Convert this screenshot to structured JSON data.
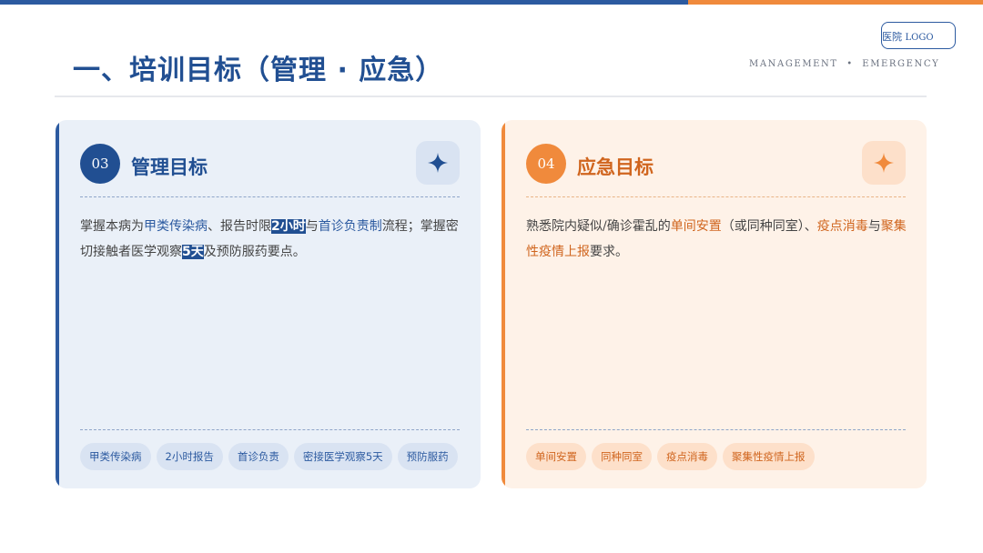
{
  "header": {
    "title": "一、培训目标（管理 · 应急）",
    "logo_text": "医院",
    "logo_suffix": "LOGO",
    "subtitle": "MANAGEMENT  •  EMERGENCY"
  },
  "colors": {
    "primary_blue": "#214f92",
    "accent_orange": "#f08a3c"
  },
  "cards": [
    {
      "number": "03",
      "title": "管理目标",
      "icon": "sparkle-icon",
      "text": {
        "t1": "掌握本病为",
        "h1": "甲类传染病",
        "t2": "、报告时限",
        "m1": "2小时",
        "t3": "与",
        "h2": "首诊负责制",
        "t4": "流程；掌握密切接触者医学观察",
        "m2": "5天",
        "t5": "及预防服药要点。"
      },
      "tags": [
        "甲类传染病",
        "2小时报告",
        "首诊负责",
        "密接医学观察5天",
        "预防服药"
      ]
    },
    {
      "number": "04",
      "title": "应急目标",
      "icon": "sparkle-icon",
      "text": {
        "t1": "熟悉院内疑似/确诊霍乱的",
        "h1": "单间安置",
        "t2": "（或同种同室）、",
        "h2": "疫点消毒",
        "t3": "与",
        "h3": "聚集性疫情上报",
        "t4": "要求。"
      },
      "tags": [
        "单间安置",
        "同种同室",
        "疫点消毒",
        "聚集性疫情上报"
      ]
    }
  ]
}
